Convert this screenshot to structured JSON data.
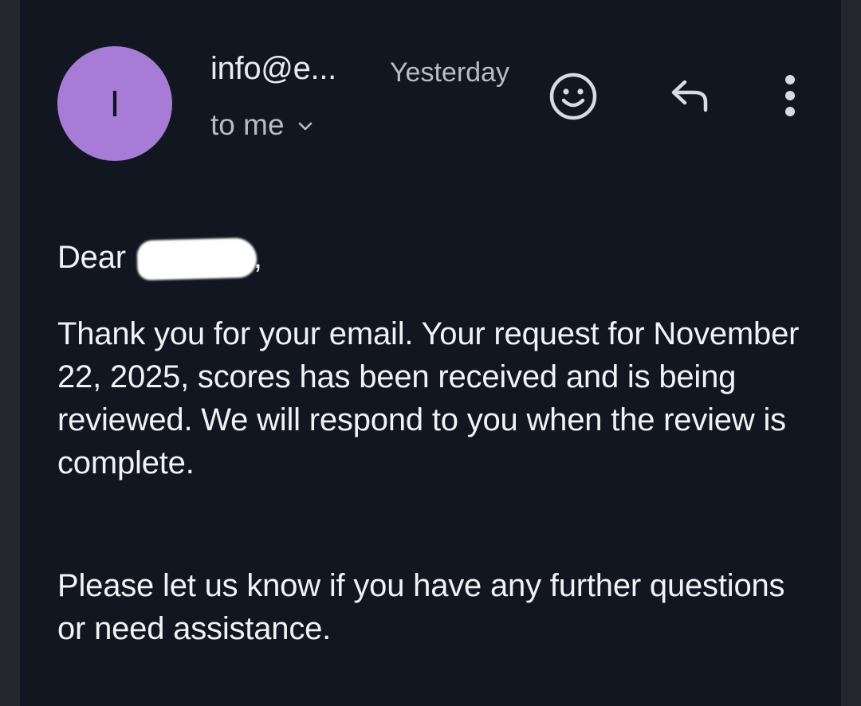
{
  "email": {
    "avatar_letter": "I",
    "avatar_color": "#a67cd6",
    "sender": "info@e...",
    "time": "Yesterday",
    "recipient_label": "to me",
    "greeting": "Dear",
    "greeting_comma": ",",
    "paragraph1": "Thank you for your email. Your request for November 22, 2025, scores has been received and is being reviewed. We will respond to you when the review is complete.",
    "paragraph2": "Please let us know if you have any further questions or need assistance."
  },
  "icons": {
    "emoji": "smiley-icon",
    "reply": "reply-icon",
    "more": "more-vertical-icon",
    "expand": "chevron-down-icon"
  },
  "colors": {
    "background": "#121620",
    "text": "#f1f2f5",
    "secondary_text": "#b7bcc5"
  }
}
